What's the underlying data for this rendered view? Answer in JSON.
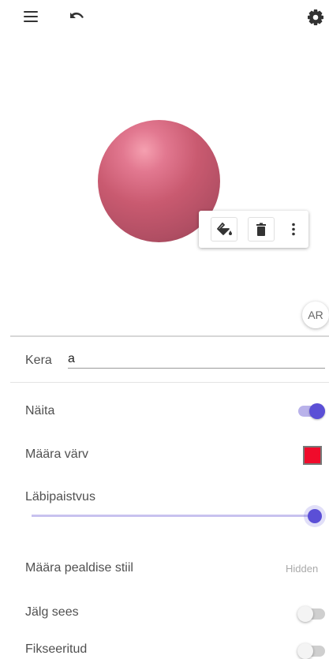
{
  "toolbar": {
    "menu_icon": "menu-icon",
    "undo_icon": "undo-icon",
    "settings_icon": "settings-icon"
  },
  "view": {
    "object_color": "#c95a70",
    "style_bar": {
      "icons": [
        "paint-bucket-icon",
        "trash-icon",
        "more-vert-icon"
      ]
    },
    "ar_label": "AR"
  },
  "properties": {
    "name_label": "Kera",
    "name_value": "a",
    "show_label": "Näita",
    "show_on": true,
    "color_label": "Määra värv",
    "color_value": "#f00b2b",
    "opacity_label": "Läbipaistvus",
    "opacity_value": 1.0,
    "caption_label": "Määra pealdise stiil",
    "caption_value": "Hidden",
    "trace_label": "Jälg sees",
    "trace_on": false,
    "fixed_label": "Fikseeritud",
    "fixed_on": false
  },
  "colors": {
    "accent": "#5b4fd6",
    "accent_light": "#b9b2ea"
  }
}
